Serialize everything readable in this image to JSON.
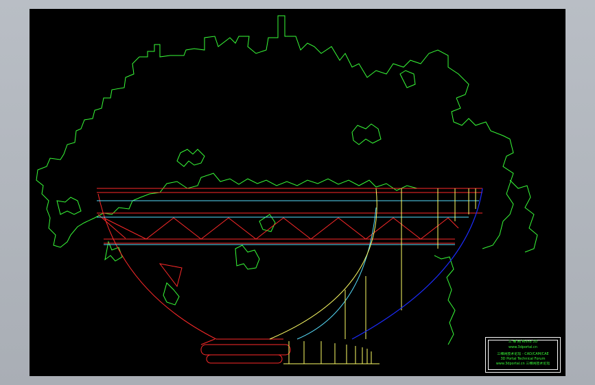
{
  "colors": {
    "background": "#000000",
    "foliage": "#39ff39",
    "frame_red": "#ff2a2a",
    "rim_cyan": "#58e0ff",
    "accent_yellow": "#ffff66",
    "accent_blue": "#1c2cff",
    "title_text": "#39ff39",
    "outer_gray": "#b4b9c0"
  },
  "title_block": {
    "line1": "三 维 网  Rhino 3D",
    "line2": "www.3dportal.cn",
    "line3": "三维网技术论坛 - CAD/CAM/CAE",
    "line4": "3D Portal Technical Forum",
    "line5": "www.3dportal.cn  三维网技术论坛"
  }
}
